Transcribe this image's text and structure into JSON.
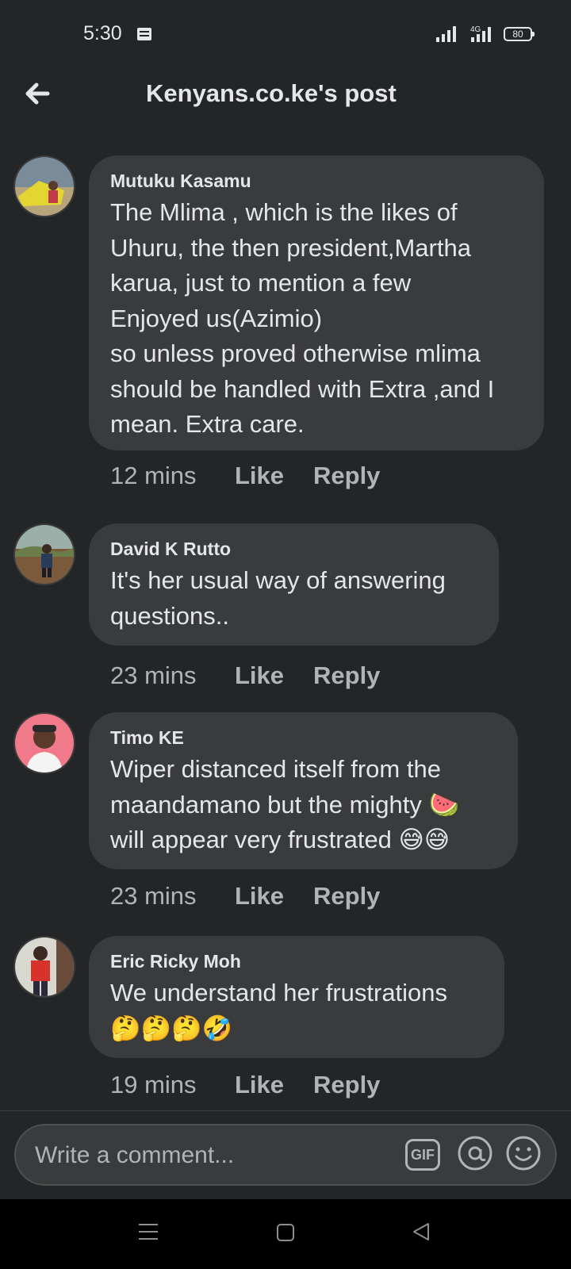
{
  "status_bar": {
    "time": "5:30",
    "network": "4G",
    "battery": "80"
  },
  "header": {
    "title": "Kenyans.co.ke's post"
  },
  "comments": [
    {
      "author": "Mutuku Kasamu",
      "lines": [
        "The Mlima , which is the likes of",
        "Uhuru, the then president,Martha",
        "karua, just to mention a few",
        "Enjoyed us(Azimio)",
        "so unless proved otherwise mlima",
        "should be handled with Extra ,and I",
        "mean. Extra care."
      ],
      "time": "12 mins",
      "like": "Like",
      "reply": "Reply"
    },
    {
      "author": "David K Rutto",
      "lines": [
        "It's her usual way of answering",
        "questions.."
      ],
      "time": "23 mins",
      "like": "Like",
      "reply": "Reply"
    },
    {
      "author": "Timo KE",
      "lines": [
        "Wiper distanced itself from the",
        "maandamano but the mighty",
        "will appear very frustrated"
      ],
      "emoji_line2": "🍉",
      "emoji_line3": "😅😅",
      "time": "23 mins",
      "like": "Like",
      "reply": "Reply"
    },
    {
      "author": "Eric Ricky Moh",
      "lines": [
        "We understand her frustrations",
        "🤔🤔🤔🤣"
      ],
      "time": "19 mins",
      "like": "Like",
      "reply": "Reply"
    }
  ],
  "composer": {
    "placeholder": "Write a comment...",
    "gif_label": "GIF"
  },
  "icons": {
    "back": "back-arrow-icon",
    "gif": "gif-icon",
    "mention": "at-icon",
    "emoji": "smiley-icon"
  },
  "colors": {
    "background": "#242526",
    "bubble": "#3a3b3c",
    "text": "#e4e6eb",
    "secondary_text": "#b0b3b8"
  }
}
